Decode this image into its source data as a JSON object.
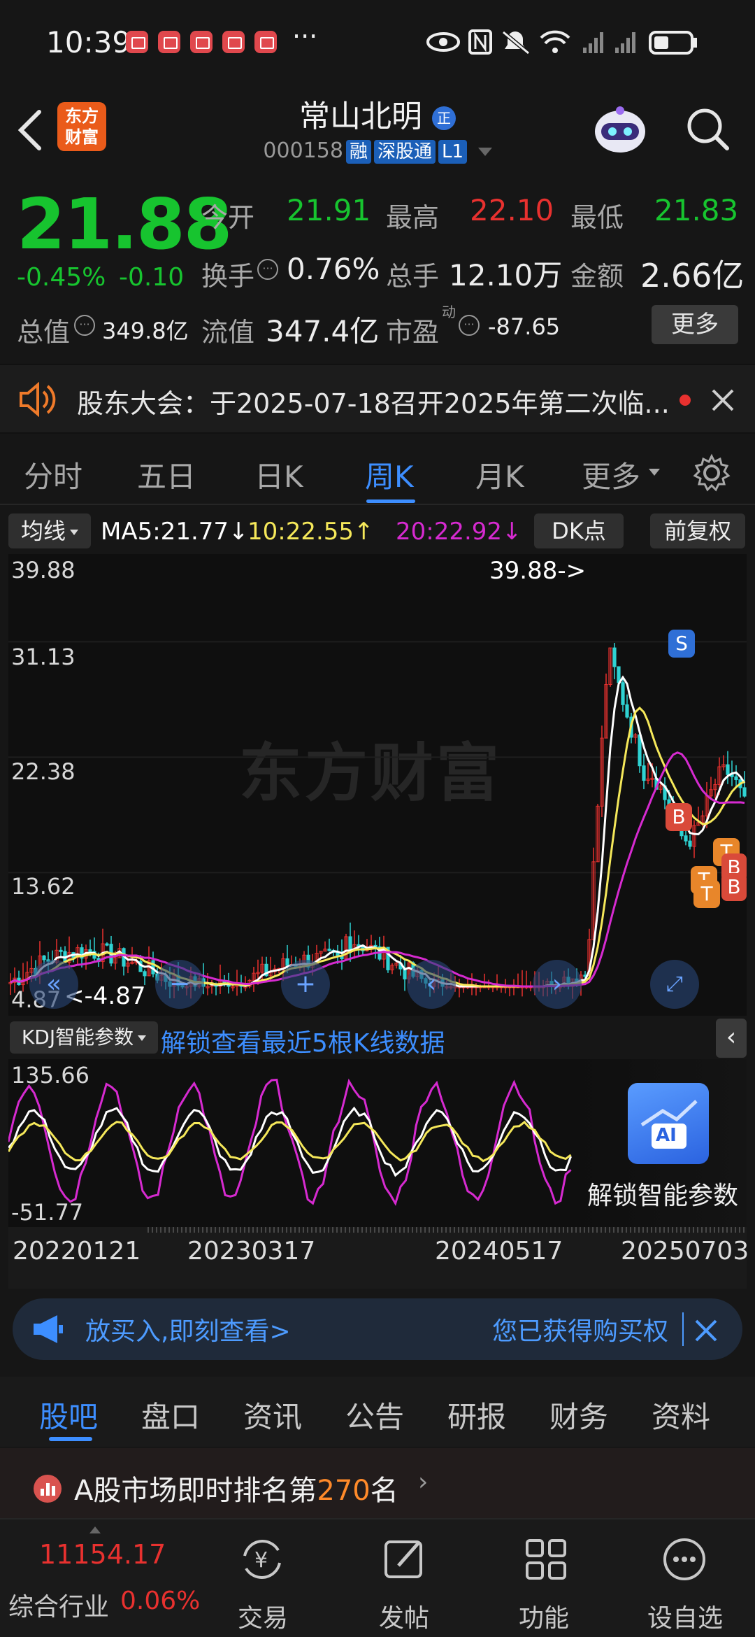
{
  "status_bar": {
    "time": "10:39",
    "more": "···"
  },
  "header": {
    "stock_name": "常山北明",
    "badge": "正",
    "code": "000158",
    "tags": [
      "融",
      "深股通",
      "L1"
    ],
    "logo_text": "东方财富"
  },
  "quote": {
    "price": "21.88",
    "change_pct": "-0.45%",
    "change_val": "-0.10",
    "open_label": "今开",
    "open": "21.91",
    "high_label": "最高",
    "high": "22.10",
    "low_label": "最低",
    "low": "21.83",
    "turnover_label": "换手",
    "turnover": "0.76%",
    "volume_label": "总手",
    "volume": "12.10万",
    "amount_label": "金额",
    "amount": "2.66亿",
    "total_value_label": "总值",
    "total_value": "349.8亿",
    "float_value_label": "流值",
    "float_value": "347.4亿",
    "pe_label": "市盈",
    "pe_sup": "动",
    "pe": "-87.65",
    "more_button": "更多"
  },
  "notice": {
    "text": "股东大会：于2025-07-18召开2025年第二次临..."
  },
  "chart_tabs": {
    "items": [
      "分时",
      "五日",
      "日K",
      "周K",
      "月K",
      "更多"
    ],
    "active": "周K"
  },
  "ma_row": {
    "selector": "均线",
    "ma5": "MA5:21.77",
    "ma5_arrow": "↓",
    "ma10": "10:22.55",
    "ma10_arrow": "↑",
    "ma20": "20:22.92",
    "ma20_arrow": "↓",
    "dk_button": "DK点",
    "adjust_button": "前复权"
  },
  "kchart": {
    "y_ticks": [
      "39.88",
      "31.13",
      "22.38",
      "13.62",
      "4.87"
    ],
    "max_marker": "39.88->",
    "min_marker": "<-4.87",
    "watermark": "东方财富",
    "signals": [
      "S",
      "B",
      "T",
      "B",
      "T",
      "B",
      "T"
    ]
  },
  "kdj": {
    "selector": "KDJ智能参数",
    "unlock_link": "解锁查看最近5根K线数据",
    "y_max": "135.66",
    "y_min": "-51.77",
    "ai_label": "AI",
    "ai_unlock": "解锁智能参数"
  },
  "dates": [
    "20220121",
    "20230317",
    "20240517",
    "20250703"
  ],
  "ad_bar": {
    "left_text": "放买入,即刻查看>",
    "right_text": "您已获得购买权"
  },
  "bottom_tabs": {
    "items": [
      "股吧",
      "盘口",
      "资讯",
      "公告",
      "研报",
      "财务",
      "资料"
    ],
    "active": "股吧"
  },
  "rank": {
    "prefix": "A股市场即时排名第",
    "number": "270",
    "suffix": "名"
  },
  "footer": {
    "index_value": "11154.17",
    "index_name": "综合行业",
    "index_change": "0.06%",
    "items": [
      "交易",
      "发帖",
      "功能",
      "设自选"
    ]
  },
  "colors": {
    "up": "#e8312f",
    "down": "#17c42f",
    "accent": "#3d8eff",
    "ma5": "#ffffff",
    "ma10": "#f5e85a",
    "ma20": "#d62ad0"
  }
}
